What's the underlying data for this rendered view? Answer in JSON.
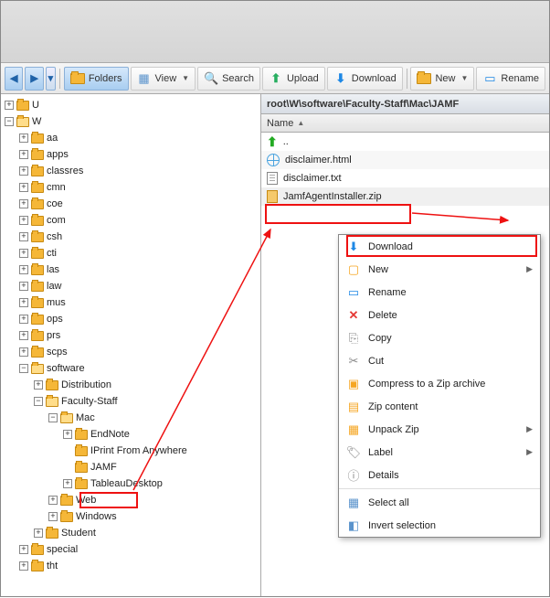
{
  "toolbar": {
    "folders": "Folders",
    "view": "View",
    "search": "Search",
    "upload": "Upload",
    "download": "Download",
    "new": "New",
    "rename": "Rename"
  },
  "tree": {
    "u": "U",
    "w": "W",
    "aa": "aa",
    "apps": "apps",
    "classres": "classres",
    "cmn": "cmn",
    "coe": "coe",
    "com": "com",
    "csh": "csh",
    "cti": "cti",
    "las": "las",
    "law": "law",
    "mus": "mus",
    "ops": "ops",
    "prs": "prs",
    "scps": "scps",
    "software": "software",
    "distribution": "Distribution",
    "faculty_staff": "Faculty-Staff",
    "mac": "Mac",
    "endnote": "EndNote",
    "iprint": "IPrint From Anywhere",
    "jamf": "JAMF",
    "tableau": "TableauDesktop",
    "web": "Web",
    "windows": "Windows",
    "student": "Student",
    "special": "special",
    "tht": "tht"
  },
  "breadcrumb": "root\\W\\software\\Faculty-Staff\\Mac\\JAMF",
  "column": {
    "name": "Name"
  },
  "files": {
    "up": "..",
    "disclaimer_html": "disclaimer.html",
    "disclaimer_txt": "disclaimer.txt",
    "installer": "JamfAgentInstaller.zip"
  },
  "context_menu": {
    "download": "Download",
    "new": "New",
    "rename": "Rename",
    "delete": "Delete",
    "copy": "Copy",
    "cut": "Cut",
    "compress": "Compress to a Zip archive",
    "zip_content": "Zip content",
    "unpack": "Unpack Zip",
    "label": "Label",
    "details": "Details",
    "select_all": "Select all",
    "invert": "Invert selection"
  }
}
